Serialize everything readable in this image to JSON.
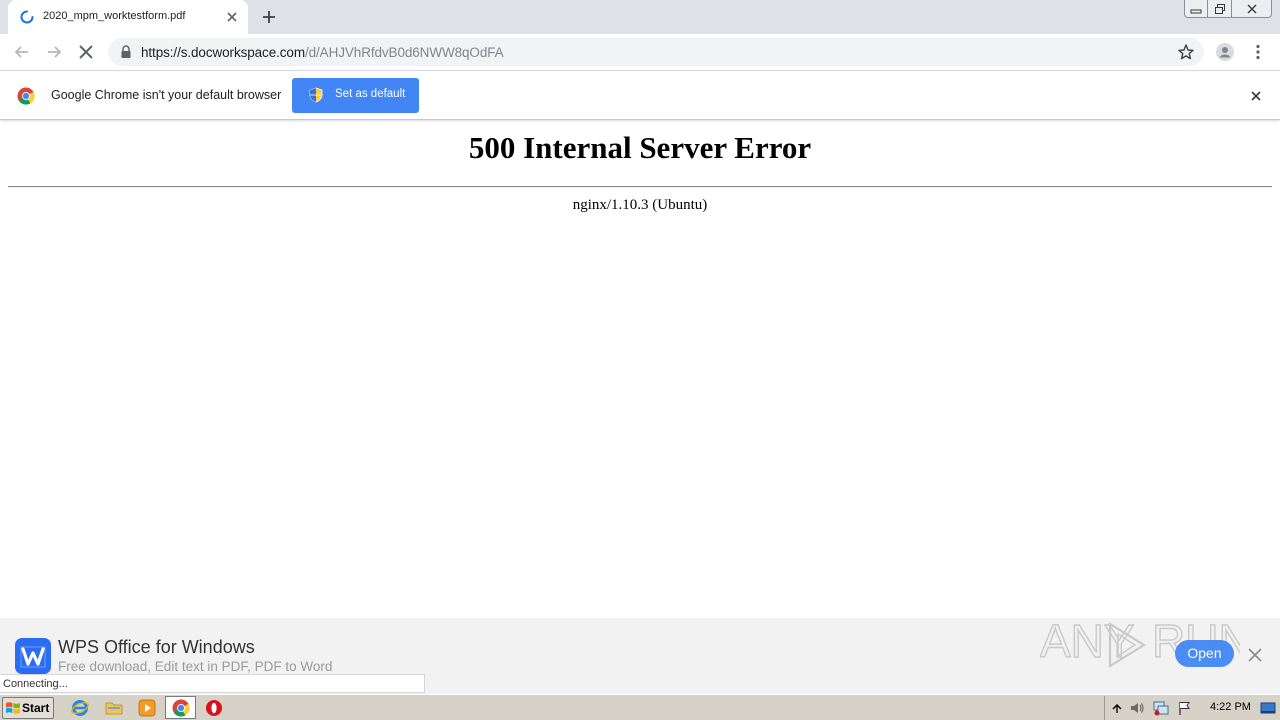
{
  "browser": {
    "tab": {
      "title": "2020_mpm_worktestform.pdf"
    },
    "omnibox": {
      "url_host": "https://s.docworkspace.com",
      "url_path": "/d/AHJVhRfdvB0d6NWW8qOdFA"
    }
  },
  "infobar": {
    "message": "Google Chrome isn't your default browser",
    "button_label": "Set as default"
  },
  "page": {
    "title": "500 Internal Server Error",
    "server": "nginx/1.10.3 (Ubuntu)"
  },
  "ad": {
    "title": "WPS Office for Windows",
    "subtitle": "Free download, Edit text in PDF, PDF to Word",
    "open_label": "Open",
    "watermark": "ANY RUN"
  },
  "status": {
    "text": "Connecting..."
  },
  "taskbar": {
    "start_label": "Start",
    "clock": "4:22 PM"
  },
  "colors": {
    "accent": "#4285f4",
    "tabstrip": "#dee1e6",
    "taskbar": "#d6d2c8",
    "wps_blue": "#2a6df4"
  },
  "icons": [
    "tab-loading-spinner-icon",
    "tab-close-icon",
    "new-tab-icon",
    "minimize-icon",
    "restore-icon",
    "window-close-icon",
    "back-arrow-icon",
    "forward-arrow-icon",
    "stop-loading-icon",
    "lock-icon",
    "bookmark-star-icon",
    "profile-avatar-icon",
    "kebab-menu-icon",
    "chrome-logo-icon",
    "uac-shield-icon",
    "infobar-close-icon",
    "wps-logo-icon",
    "banner-close-icon",
    "windows-flag-icon",
    "internet-explorer-icon",
    "folder-icon",
    "media-player-icon",
    "chrome-taskbar-icon",
    "opera-icon",
    "tray-chevron-icon",
    "volume-icon",
    "network-icon",
    "action-center-flag-icon",
    "show-desktop-icon"
  ]
}
